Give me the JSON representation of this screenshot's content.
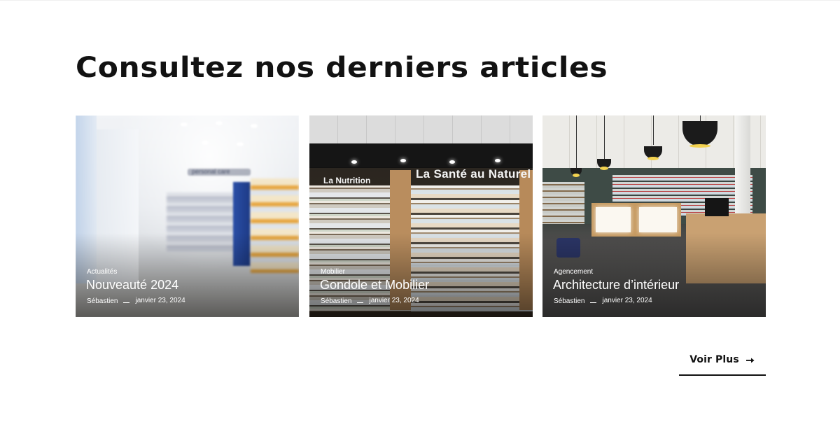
{
  "section": {
    "title": "Consultez nos derniers articles"
  },
  "articles": [
    {
      "category": "Actualités",
      "title": "Nouveauté 2024",
      "author": "Sébastien",
      "date": "janvier 23, 2024"
    },
    {
      "category": "Mobilier",
      "title": "Gondole et Mobilier",
      "author": "Sébastien",
      "date": "janvier 23, 2024"
    },
    {
      "category": "Agencement",
      "title": "Architecture d’intérieur",
      "author": "Sébastien",
      "date": "janvier 23, 2024"
    }
  ],
  "photo_text": {
    "card1_sign": "personal care",
    "card2_sign_left": "La Nutrition",
    "card2_sign_right": "La Santé au Naturel"
  },
  "more_button": {
    "label": "Voir Plus",
    "icon": "arrow-right-icon"
  }
}
